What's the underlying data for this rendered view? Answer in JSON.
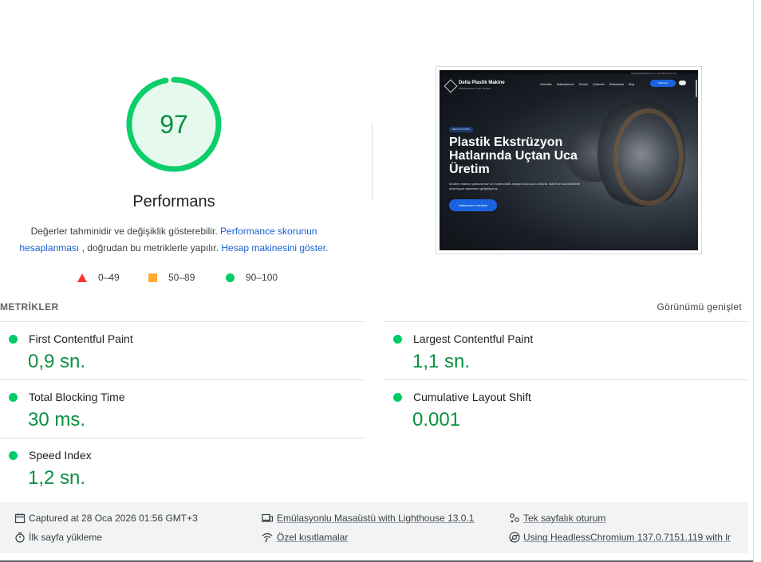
{
  "gauge": {
    "score": "97",
    "fraction": 0.97,
    "color": "#0cce6b"
  },
  "category": {
    "title": "Performans"
  },
  "description": {
    "text1": "Değerler tahminidir ve değişiklik gösterebilir.",
    "link1": "Performance skorunun hesaplanması",
    "text2": ", doğrudan bu metriklerle yapılır.",
    "link2": "Hesap makinesini göster."
  },
  "legend": [
    {
      "range": "0–49",
      "shape": "triangle",
      "color": "#ff3333"
    },
    {
      "range": "50–89",
      "shape": "square",
      "color": "#ffaa33"
    },
    {
      "range": "90–100",
      "shape": "circle",
      "color": "#00cc66"
    }
  ],
  "thumbnail": {
    "top_contact": "info@deltaplastik.com  |  +90 530 000 00 00",
    "brand": "Delta Plastik Makine",
    "brand_sub": "Plastik Makine Üretim Merkezi",
    "nav": [
      "Hizmetler",
      "Makinalarımız",
      "Ürünler",
      "Çözümler",
      "Referanslar",
      "Blog"
    ],
    "nav_button": "Teklif Alın",
    "badge": "DELTA PLASTİK",
    "hero": "Plastik Ekstrüzyon Hatlarında Uçtan Uca Üretim",
    "hero_sub": "Modern makine parkurumuz ve mühendislik altyapımızla uzun ömürlü, stabil ve sürdürülebilir ekstrüzyon sistemleri geliştiriyoruz.",
    "cta": "Hatlarımızı İnceleyin"
  },
  "metrics_section": {
    "title": "METRİKLER",
    "expand": "Görünümü genişlet"
  },
  "metrics": [
    {
      "label": "First Contentful Paint",
      "value": "0,9 sn."
    },
    {
      "label": "Largest Contentful Paint",
      "value": "1,1 sn."
    },
    {
      "label": "Total Blocking Time",
      "value": "30 ms."
    },
    {
      "label": "Cumulative Layout Shift",
      "value": "0.001"
    },
    {
      "label": "Speed Index",
      "value": "1,2 sn."
    }
  ],
  "footer": {
    "captured": "Captured at 28 Oca 2026 01:56 GMT+3",
    "emulation": "Emülasyonlu Masaüstü with Lighthouse 13.0.1",
    "session": "Tek sayfalık oturum",
    "load": "İlk sayfa yükleme",
    "throttling": "Özel kısıtlamalar",
    "browser": "Using HeadlessChromium 137.0.7151.119 with lr"
  },
  "icons": {
    "calendar": "calendar-icon",
    "devices": "devices-icon",
    "session": "session-icon",
    "timer": "timer-icon",
    "network": "network-icon",
    "chrome": "chrome-icon"
  }
}
